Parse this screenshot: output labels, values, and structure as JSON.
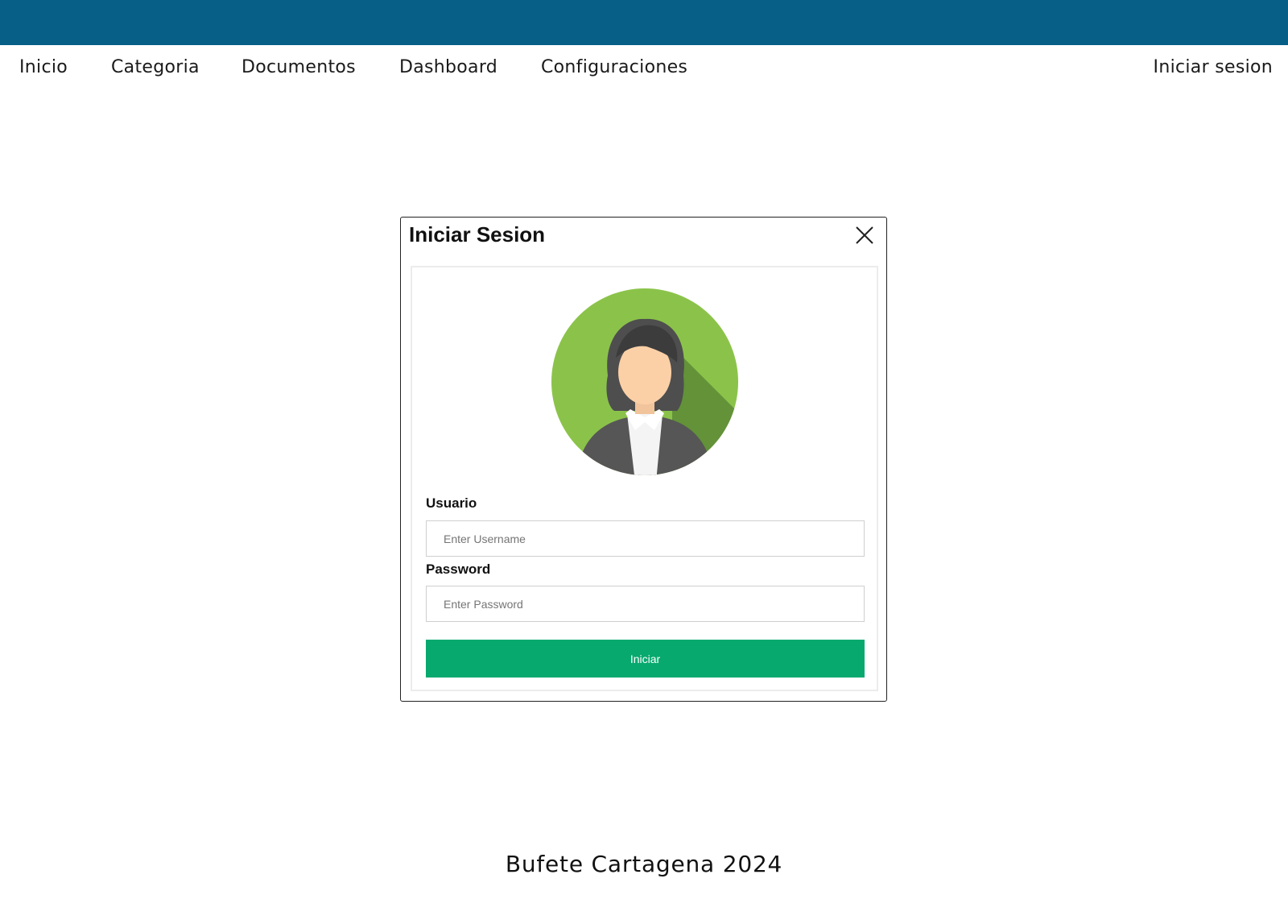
{
  "nav": {
    "items": [
      {
        "label": "Inicio"
      },
      {
        "label": "Categoria"
      },
      {
        "label": "Documentos"
      },
      {
        "label": "Dashboard"
      },
      {
        "label": "Configuraciones"
      }
    ],
    "login_label": "Iniciar sesion"
  },
  "modal": {
    "title": "Iniciar Sesion",
    "close_icon": "close-icon",
    "avatar_icon": "female-user-avatar-icon",
    "username": {
      "label": "Usuario",
      "placeholder": "Enter Username",
      "value": ""
    },
    "password": {
      "label": "Password",
      "placeholder": "Enter Password",
      "value": ""
    },
    "submit_label": "Iniciar"
  },
  "footer": {
    "text": "Bufete Cartagena 2024"
  },
  "colors": {
    "topbar": "#075f87",
    "submit_button": "#07a96f",
    "avatar_background": "#8bc34a"
  }
}
